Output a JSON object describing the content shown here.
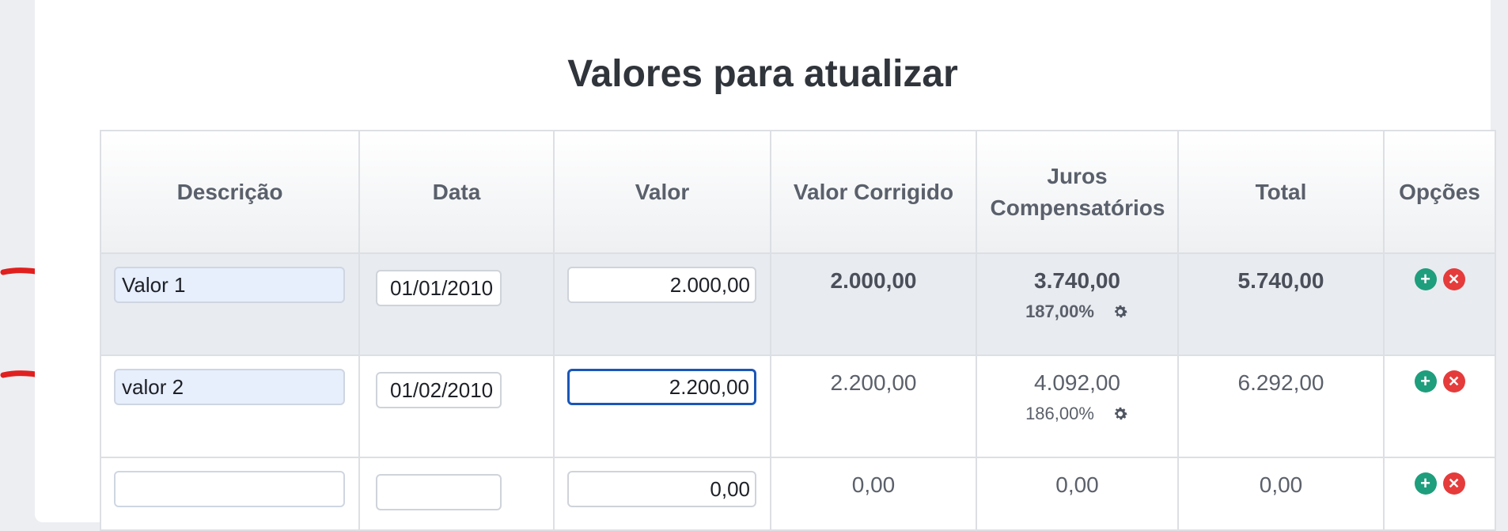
{
  "title": "Valores para atualizar",
  "columns": [
    "Descrição",
    "Data",
    "Valor",
    "Valor Corrigido",
    "Juros Compensatórios",
    "Total",
    "Opções"
  ],
  "rows": [
    {
      "descricao": "Valor 1",
      "data": "01/01/2010",
      "valor": "2.000,00",
      "valor_corrigido": "2.000,00",
      "juros": "3.740,00",
      "juros_pct": "187,00%",
      "total": "5.740,00"
    },
    {
      "descricao": "valor 2",
      "data": "01/02/2010",
      "valor": "2.200,00",
      "valor_corrigido": "2.200,00",
      "juros": "4.092,00",
      "juros_pct": "186,00%",
      "total": "6.292,00"
    },
    {
      "descricao": "",
      "data": "",
      "valor": "0,00",
      "valor_corrigido": "0,00",
      "juros": "0,00",
      "total": "0,00"
    }
  ],
  "options": {
    "add_symbol": "+",
    "remove_symbol": "✕"
  },
  "colors": {
    "add": "#1e9e7c",
    "remove": "#e53b3b",
    "focus": "#1a56b8",
    "arrow": "#e0201f"
  },
  "icons": [
    "gear-icon",
    "add-icon",
    "remove-icon",
    "red-arrow-annotation"
  ]
}
